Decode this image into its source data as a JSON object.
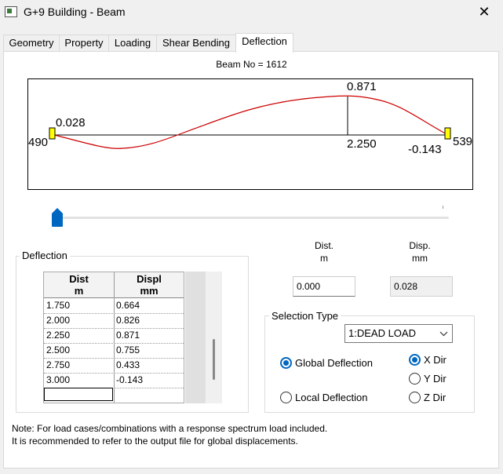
{
  "window": {
    "title": "G+9 Building - Beam",
    "close_glyph": "✕"
  },
  "tabs": [
    {
      "label": "Geometry"
    },
    {
      "label": "Property"
    },
    {
      "label": "Loading"
    },
    {
      "label": "Shear Bending"
    },
    {
      "label": "Deflection",
      "active": true
    }
  ],
  "beam": {
    "label": "Beam No = 1612",
    "start_node": "490",
    "end_node": "539",
    "start_value": "0.028",
    "max_value": "0.871",
    "max_position": "2.250",
    "end_value": "-0.143",
    "curve_color": "#cc0000"
  },
  "deflection_group": {
    "title": "Deflection",
    "headers": [
      {
        "line1": "Dist",
        "line2": "m"
      },
      {
        "line1": "Displ",
        "line2": "mm"
      }
    ],
    "rows": [
      {
        "dist": "1.750",
        "displ": "0.664"
      },
      {
        "dist": "2.000",
        "displ": "0.826"
      },
      {
        "dist": "2.250",
        "displ": "0.871"
      },
      {
        "dist": "2.500",
        "displ": "0.755"
      },
      {
        "dist": "2.750",
        "displ": "0.433"
      },
      {
        "dist": "3.000",
        "displ": "-0.143"
      }
    ]
  },
  "readout": {
    "dist_label": "Dist.",
    "dist_unit": "m",
    "disp_label": "Disp.",
    "disp_unit": "mm",
    "dist_value": "0.000",
    "disp_value": "0.028"
  },
  "selection": {
    "title": "Selection Type",
    "load_case": "1:DEAD LOAD",
    "global_label": "Global Deflection",
    "local_label": "Local Deflection",
    "x_dir": "X Dir",
    "y_dir": "Y Dir",
    "z_dir": "Z Dir"
  },
  "note": {
    "line1": "Note: For load cases/combinations with a response spectrum load included.",
    "line2": "It is recommended to refer to the output file for global displacements."
  },
  "colors": {
    "accent": "#0067c0",
    "node_marker": "#ffff00"
  }
}
